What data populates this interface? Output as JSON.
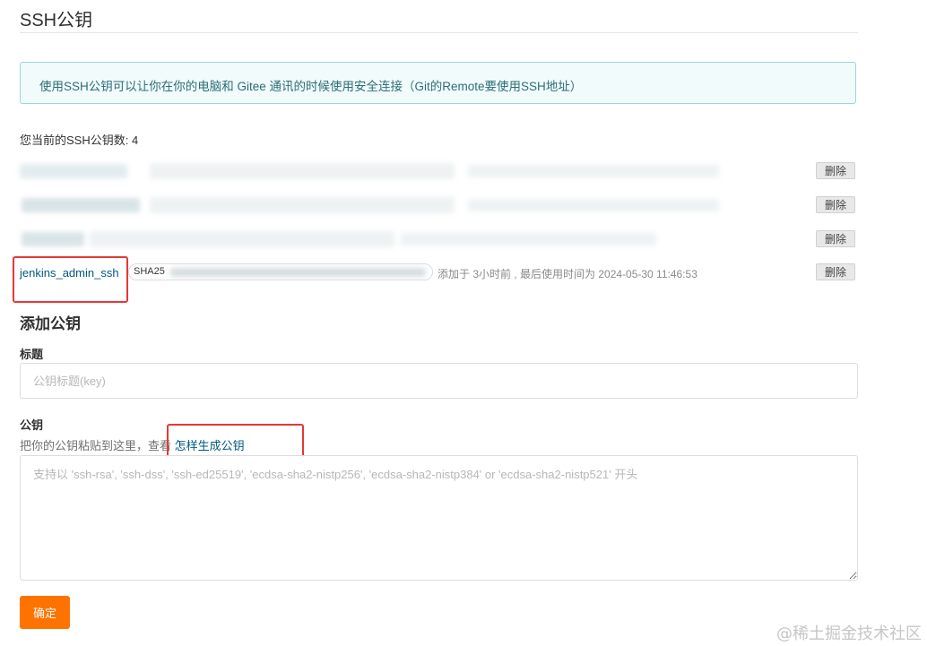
{
  "page": {
    "title": "SSH公钥",
    "info": "使用SSH公钥可以让你在你的电脑和 Gitee 通讯的时候使用安全连接（Git的Remote要使用SSH地址）",
    "count_text": "您当前的SSH公钥数: 4"
  },
  "keys": [
    {
      "delete_label": "删除"
    },
    {
      "delete_label": "删除"
    },
    {
      "delete_label": "删除"
    },
    {
      "name": "jenkins_admin_ssh",
      "fingerprint_prefix": "SHA25",
      "meta": "添加于 3小时前 , 最后使用时间为 2024-05-30 11:46:53",
      "delete_label": "删除"
    }
  ],
  "add_key": {
    "section_title": "添加公钥",
    "title_label": "标题",
    "title_placeholder": "公钥标题(key)",
    "key_label": "公钥",
    "hint_prefix": "把你的公钥粘贴到这里，查看 ",
    "hint_link": "怎样生成公钥",
    "key_placeholder": "支持以 'ssh-rsa', 'ssh-dss', 'ssh-ed25519', 'ecdsa-sha2-nistp256', 'ecdsa-sha2-nistp384' or 'ecdsa-sha2-nistp521' 开头",
    "submit_label": "确定"
  },
  "watermark": "@稀土掘金技术社区",
  "colors": {
    "accent": "#fe7300",
    "link": "#005980",
    "info_border": "#9fd4d8",
    "highlight": "#e53935"
  }
}
